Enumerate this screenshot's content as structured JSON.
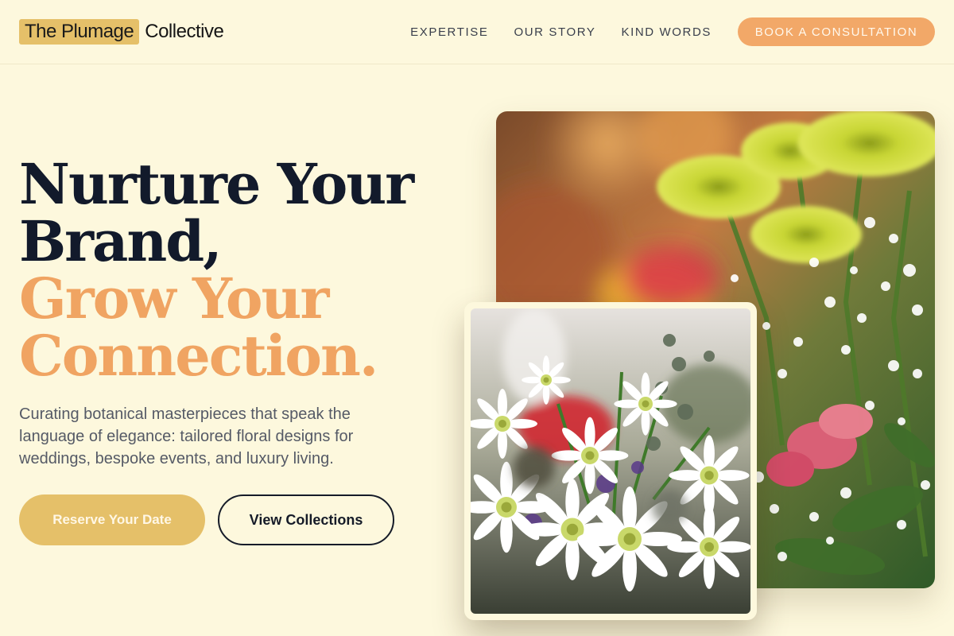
{
  "brand": {
    "highlight": "The Plumage",
    "rest": "Collective"
  },
  "nav": {
    "items": [
      "EXPERTISE",
      "OUR STORY",
      "KIND WORDS"
    ],
    "cta": "BOOK A CONSULTATION"
  },
  "hero": {
    "line1": "Nurture Your",
    "line2": "Brand,",
    "line3": "Grow Your",
    "line4": "Connection.",
    "subtitle": "Curating botanical masterpieces that speak the language of elegance: tailored floral designs for weddings, bespoke events, and luxury living.",
    "primary_button": "Reserve Your Date",
    "secondary_button": "View Collections"
  },
  "images": {
    "large": "bouquet-yellow-chrysanthemums-photo",
    "small": "bouquet-white-daisies-photo"
  },
  "colors": {
    "background": "#fdf8dd",
    "accent_orange": "#f0a462",
    "accent_gold": "#e5c069",
    "dark": "#121a2b"
  }
}
